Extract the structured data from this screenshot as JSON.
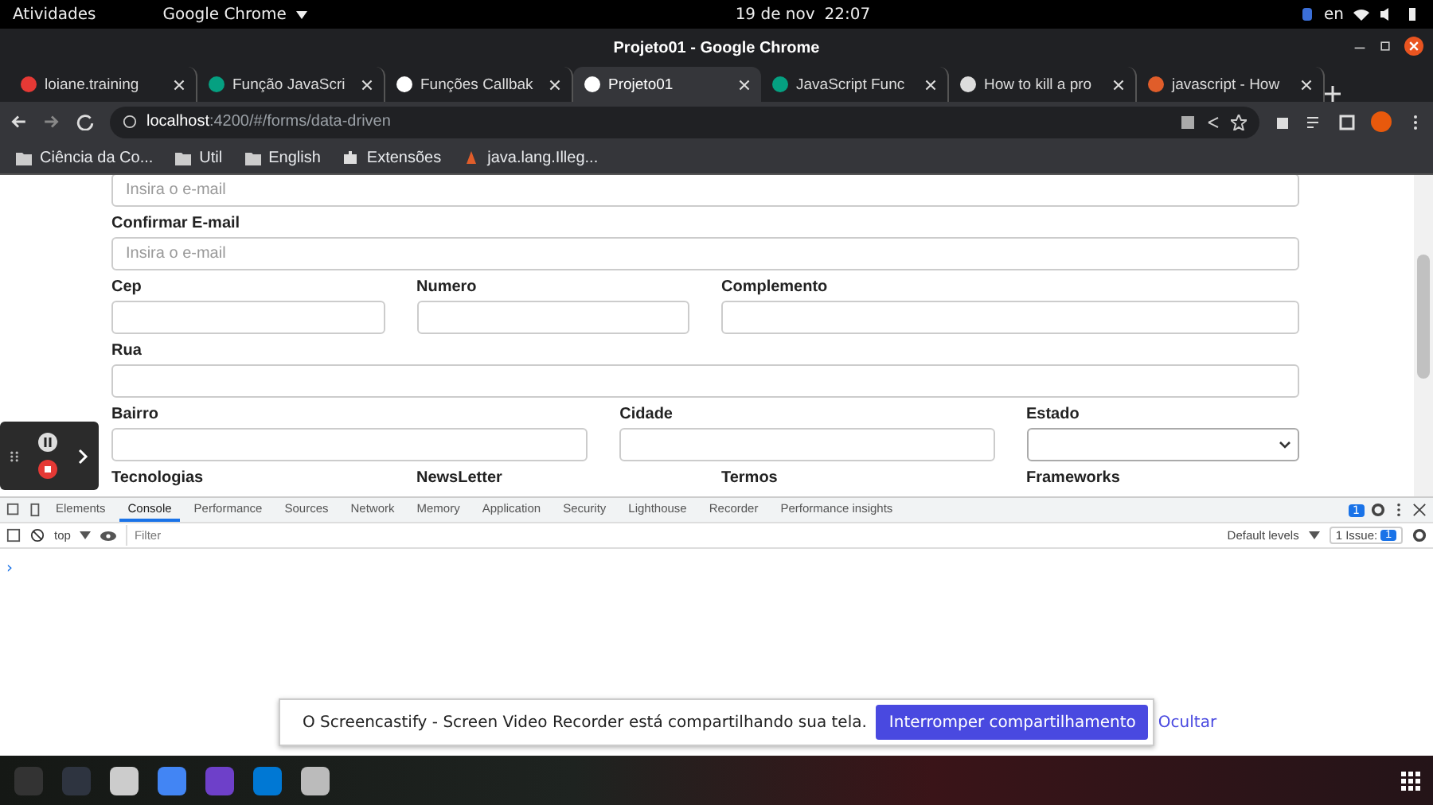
{
  "top_bar": {
    "activities": "Atividades",
    "app_menu": "Google Chrome",
    "date": "19 de nov",
    "time": "22:07",
    "language": "en"
  },
  "window": {
    "title": "Projeto01 - Google Chrome"
  },
  "tabs": [
    {
      "label": "loiane.training",
      "selected": false
    },
    {
      "label": "Função JavaScri",
      "selected": false
    },
    {
      "label": "Funções Callbak",
      "selected": false
    },
    {
      "label": "Projeto01",
      "selected": true
    },
    {
      "label": "JavaScript Func",
      "selected": false
    },
    {
      "label": "How to kill a pro",
      "selected": false
    },
    {
      "label": "javascript - How",
      "selected": false
    }
  ],
  "address_bar": {
    "host": "localhost",
    "path": ":4200/#/forms/data-driven"
  },
  "bookmarks": [
    {
      "label": "Ciência da Co...",
      "kind": "folder"
    },
    {
      "label": "Util",
      "kind": "folder"
    },
    {
      "label": "English",
      "kind": "folder"
    },
    {
      "label": "Extensões",
      "kind": "extension"
    },
    {
      "label": "java.lang.Illeg...",
      "kind": "site"
    }
  ],
  "form": {
    "fields": [
      {
        "kind": "input",
        "placeholder": "Insira o e-mail"
      },
      {
        "kind": "input",
        "label": "Confirmar E-mail",
        "placeholder": "Insira o e-mail"
      },
      {
        "kind": "input",
        "label": "Cep"
      },
      {
        "kind": "input",
        "label": "Numero"
      },
      {
        "kind": "input",
        "label": "Complemento"
      },
      {
        "kind": "input",
        "label": "Rua"
      },
      {
        "kind": "input",
        "label": "Bairro"
      },
      {
        "kind": "input",
        "label": "Cidade"
      },
      {
        "kind": "select",
        "label": "Estado"
      },
      {
        "kind": "heading",
        "label": "Tecnologias"
      },
      {
        "kind": "heading",
        "label": "NewsLetter"
      },
      {
        "kind": "heading",
        "label": "Termos"
      },
      {
        "kind": "heading",
        "label": "Frameworks"
      }
    ]
  },
  "devtools": {
    "tabs": [
      {
        "label": "Elements",
        "selected": false
      },
      {
        "label": "Console",
        "selected": true
      },
      {
        "label": "Performance",
        "selected": false
      },
      {
        "label": "Sources",
        "selected": false
      },
      {
        "label": "Network",
        "selected": false
      },
      {
        "label": "Memory",
        "selected": false
      },
      {
        "label": "Application",
        "selected": false
      },
      {
        "label": "Security",
        "selected": false
      },
      {
        "label": "Lighthouse",
        "selected": false
      },
      {
        "label": "Recorder",
        "selected": false
      },
      {
        "label": "Performance insights",
        "selected": false
      }
    ],
    "message_count": "1",
    "context": "top",
    "filter_placeholder": "Filter",
    "levels": "Default levels",
    "issues_label": "1 Issue:",
    "issues_count": "1",
    "prompt": "›"
  },
  "share_bar": {
    "message": "O Screencastify - Screen Video Recorder está compartilhando sua tela.",
    "stop_button": "Interromper compartilhamento",
    "hide_link": "Ocultar"
  }
}
